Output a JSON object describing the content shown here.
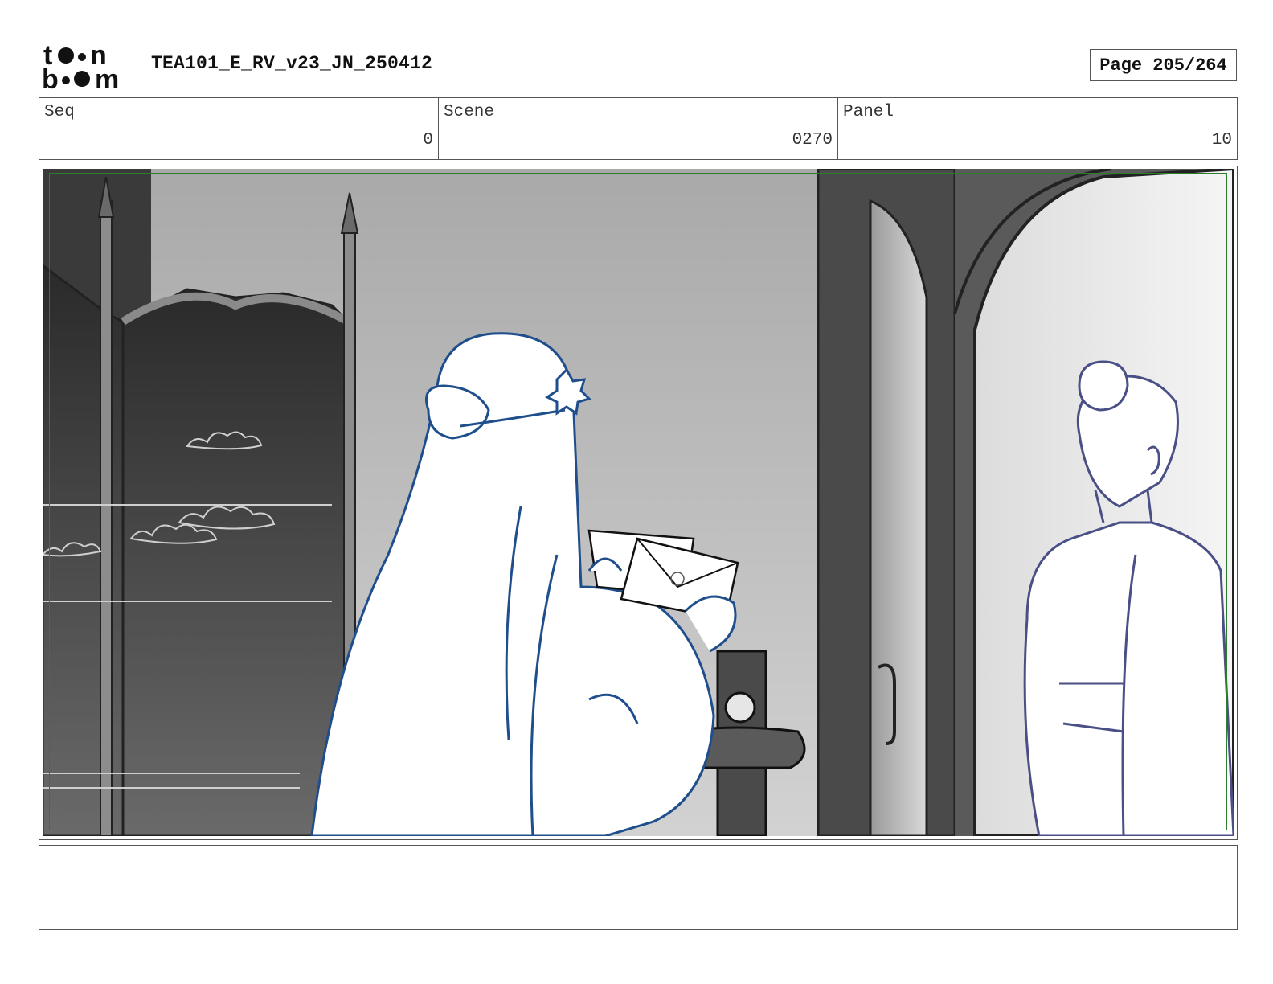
{
  "header": {
    "logo_text": "toon boom",
    "title": "TEA101_E_RV_v23_JN_250412",
    "page_label": "Page 205/264"
  },
  "info": {
    "seq_label": "Seq",
    "seq_value": "0",
    "scene_label": "Scene",
    "scene_value": "0270",
    "panel_label": "Panel",
    "panel_value": "10"
  },
  "colors": {
    "safe_frame": "#2e7d2e",
    "character_line": "#1f4e8c",
    "character_line_right": "#4a4f86",
    "border": "#555555"
  },
  "notes": {
    "text": ""
  }
}
